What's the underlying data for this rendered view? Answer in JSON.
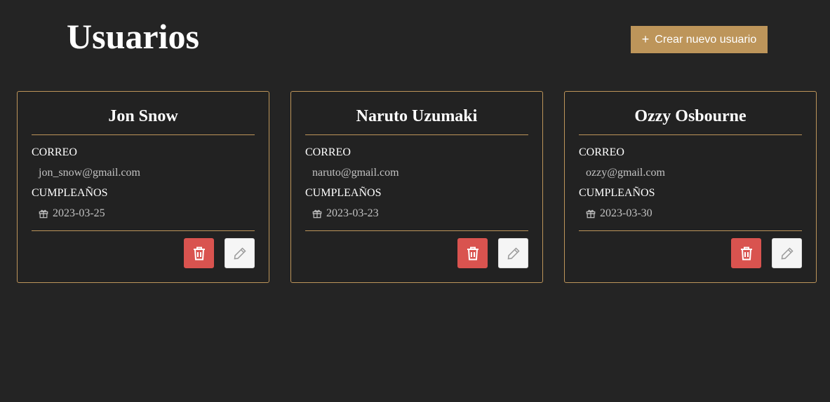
{
  "header": {
    "title": "Usuarios",
    "create_button_label": "Crear nuevo usuario",
    "create_button_icon": "plus-icon"
  },
  "labels": {
    "email": "CORREO",
    "birthday": "CUMPLEAÑOS"
  },
  "users": [
    {
      "name": "Jon Snow",
      "email": "jon_snow@gmail.com",
      "birthday": "2023-03-25"
    },
    {
      "name": "Naruto Uzumaki",
      "email": "naruto@gmail.com",
      "birthday": "2023-03-23"
    },
    {
      "name": "Ozzy Osbourne",
      "email": "ozzy@gmail.com",
      "birthday": "2023-03-30"
    }
  ],
  "icons": {
    "birthday": "gift-icon",
    "delete": "trash-icon",
    "edit": "pencil-icon"
  },
  "colors": {
    "background": "#242424",
    "accent": "#bd955a",
    "danger": "#d9534f",
    "light_button": "#f5f5f5"
  }
}
